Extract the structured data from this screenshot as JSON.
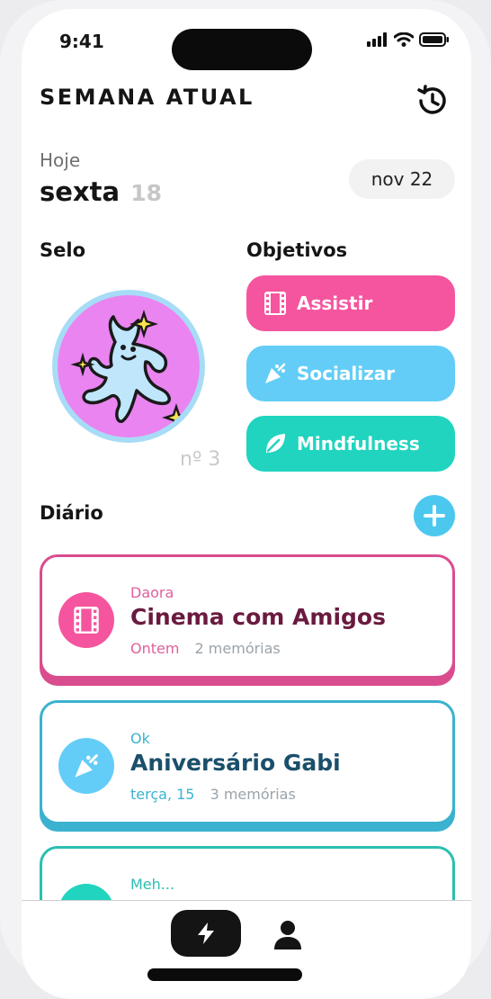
{
  "status_bar": {
    "time": "9:41"
  },
  "header": {
    "title": "SEMANA ATUAL"
  },
  "today": {
    "label": "Hoje",
    "day_name": "sexta",
    "day_number": "18",
    "month_pill": "nov 22"
  },
  "seal": {
    "heading": "Selo",
    "number": "nº 3"
  },
  "goals": {
    "heading": "Objetivos",
    "items": [
      {
        "label": "Assistir",
        "icon": "film-icon",
        "color": "#f5559e"
      },
      {
        "label": "Socializar",
        "icon": "party-popper-icon",
        "color": "#63cdf7"
      },
      {
        "label": "Mindfulness",
        "icon": "leaf-icon",
        "color": "#20d4bf"
      }
    ]
  },
  "diary": {
    "heading": "Diário",
    "entries": [
      {
        "mood": "Daora",
        "title": "Cinema com Amigos",
        "date": "Ontem",
        "count": "2 memórias",
        "accent": "#d94d8e"
      },
      {
        "mood": "Ok",
        "title": "Aniversário Gabi",
        "date": "terça, 15",
        "count": "3 memórias",
        "accent": "#3bb2cf"
      },
      {
        "mood": "Meh...",
        "title": "",
        "date": "",
        "count": "",
        "accent": "#2bbfb0"
      }
    ]
  },
  "tabbar": {
    "active": "lightning-icon",
    "other": "profile-icon"
  }
}
